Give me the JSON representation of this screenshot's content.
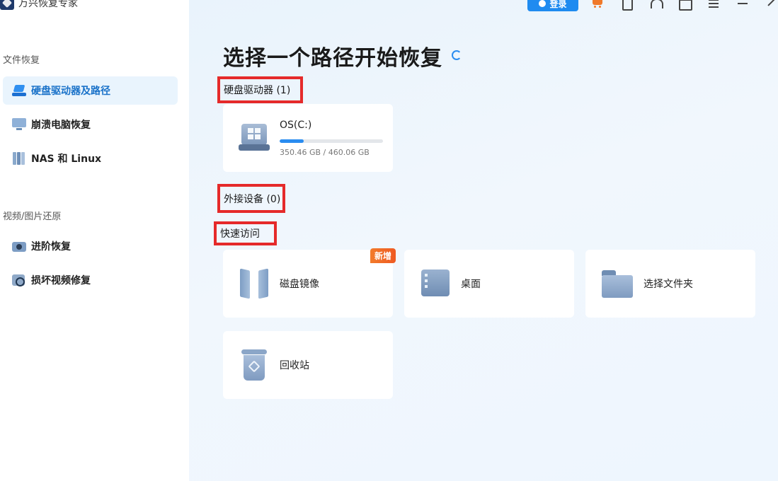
{
  "app": {
    "name": "万兴恢复专家"
  },
  "topbar": {
    "login_label": "登录"
  },
  "sidebar": {
    "section1_label": "文件恢复",
    "section2_label": "视频/图片还原",
    "items": [
      {
        "label": "硬盘驱动器及路径",
        "icon": "hard-drive-icon",
        "active": true
      },
      {
        "label": "崩溃电脑恢复",
        "icon": "monitor-icon",
        "active": false
      },
      {
        "label": "NAS 和 Linux",
        "icon": "nas-icon",
        "active": false
      },
      {
        "label": "进阶恢复",
        "icon": "camera-icon",
        "active": false
      },
      {
        "label": "损坏视频修复",
        "icon": "video-repair-icon",
        "active": false
      }
    ]
  },
  "main": {
    "title": "选择一个路径开始恢复",
    "hard_drives_header": "硬盘驱动器 (1)",
    "external_header": "外接设备 (0)",
    "quick_access_header": "快速访问",
    "drives": [
      {
        "name": "OS(C:)",
        "size_text": "350.46 GB / 460.06 GB",
        "used_fraction": 0.23
      }
    ],
    "quick_access": [
      {
        "label": "磁盘镜像",
        "icon": "disk-mirror-icon",
        "badge": "新增"
      },
      {
        "label": "桌面",
        "icon": "desktop-icon"
      },
      {
        "label": "选择文件夹",
        "icon": "folder-icon"
      },
      {
        "label": "回收站",
        "icon": "recycle-bin-icon"
      }
    ]
  },
  "colors": {
    "accent": "#2a8cf0",
    "highlight_box": "#e52a2a",
    "badge": "#f27b2b"
  }
}
